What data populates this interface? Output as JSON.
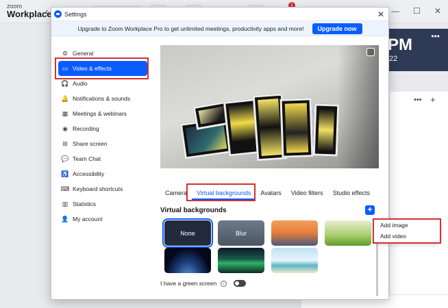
{
  "background_app": {
    "logo_small": "zoom",
    "logo_big": "Workplace",
    "notification_count": "1",
    "clock_time": "PM",
    "clock_date": "22",
    "more": "•••",
    "panel_more": "•••",
    "panel_add": "+"
  },
  "dialog": {
    "title": "Settings",
    "close": "✕",
    "upgrade_message": "Upgrade to Zoom Workplace Pro to get unlimited meetings, productivity apps and more!",
    "upgrade_button": "Upgrade now"
  },
  "sidebar": {
    "items": [
      {
        "label": "General",
        "icon": "⚙"
      },
      {
        "label": "Video & effects",
        "icon": "▭"
      },
      {
        "label": "Audio",
        "icon": "🎧"
      },
      {
        "label": "Notifications & sounds",
        "icon": "🔔"
      },
      {
        "label": "Meetings & webinars",
        "icon": "▦"
      },
      {
        "label": "Recording",
        "icon": "◉"
      },
      {
        "label": "Share screen",
        "icon": "⊞"
      },
      {
        "label": "Team Chat",
        "icon": "💬"
      },
      {
        "label": "Accessibility",
        "icon": "♿"
      },
      {
        "label": "Keyboard shortcuts",
        "icon": "⌨"
      },
      {
        "label": "Statistics",
        "icon": "▥"
      },
      {
        "label": "My account",
        "icon": "👤"
      }
    ]
  },
  "tabs": [
    "Camera",
    "Virtual backgrounds",
    "Avatars",
    "Video filters",
    "Studio effects"
  ],
  "vb": {
    "heading": "Virtual backgrounds",
    "add": "+",
    "thumbs": [
      {
        "label": "None"
      },
      {
        "label": "Blur"
      },
      {
        "label": ""
      },
      {
        "label": ""
      },
      {
        "label": ""
      },
      {
        "label": ""
      },
      {
        "label": ""
      }
    ],
    "green_screen": "I have a green screen",
    "info": "i"
  },
  "dropdown": {
    "add_image": "Add image",
    "add_video": "Add video"
  }
}
